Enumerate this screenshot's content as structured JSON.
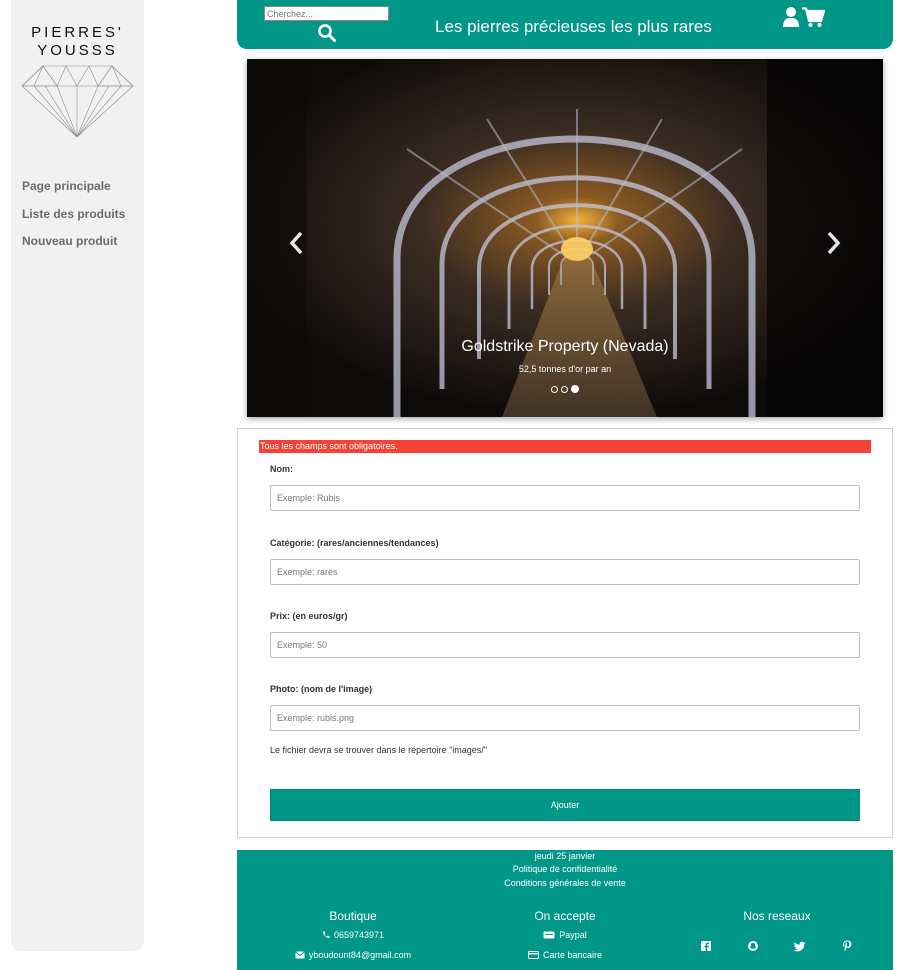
{
  "sidebar": {
    "logo_line1": "PIERRES'",
    "logo_line2": "YOUSSS",
    "nav": [
      {
        "label": "Page principale"
      },
      {
        "label": "Liste des produits"
      },
      {
        "label": "Nouveau produit"
      }
    ]
  },
  "header": {
    "search_placeholder": "Cherchez...",
    "title": "Les pierres précieuses les plus rares",
    "search_icon": "search-icon",
    "user_icon": "user-icon",
    "cart_icon": "cart-icon"
  },
  "carousel": {
    "title": "Goldstrike Property (Nevada)",
    "subtitle": "52,5 tonnes d'or par an",
    "slide_count": 3,
    "active_slide": 3
  },
  "form": {
    "alert": "Tous les champs sont obligatoires.",
    "fields": [
      {
        "label": "Nom:",
        "placeholder": "Exemple: Rubis",
        "value": ""
      },
      {
        "label": "Catégorie: (rares/anciennes/tendances)",
        "placeholder": "Exemple: rares",
        "value": ""
      },
      {
        "label": "Prix: (en euros/gr)",
        "placeholder": "Exemple: 50",
        "value": ""
      },
      {
        "label": "Photo: (nom de l'image)",
        "placeholder": "Exemple: rubis.png",
        "value": ""
      }
    ],
    "note": "Le fichier devra se trouver dans le répertoire \"images/\"",
    "submit_label": "Ajouter"
  },
  "footer": {
    "date": "jeudi 25 janvier",
    "privacy": "Politique de confidentialité",
    "terms": "Conditions générales de vente",
    "shop": {
      "title": "Boutique",
      "phone": "0659743971",
      "email": "yboudount84@gmail.com"
    },
    "payment": {
      "title": "On accepte",
      "paypal": "Paypal",
      "card": "Carte bancaire"
    },
    "social": {
      "title": "Nos reseaux",
      "icons": [
        "facebook-icon",
        "snapchat-icon",
        "twitter-icon",
        "pinterest-icon"
      ]
    }
  },
  "colors": {
    "brand": "#009688",
    "alert": "#f44336",
    "sidebar_bg": "#f1f1f1"
  }
}
